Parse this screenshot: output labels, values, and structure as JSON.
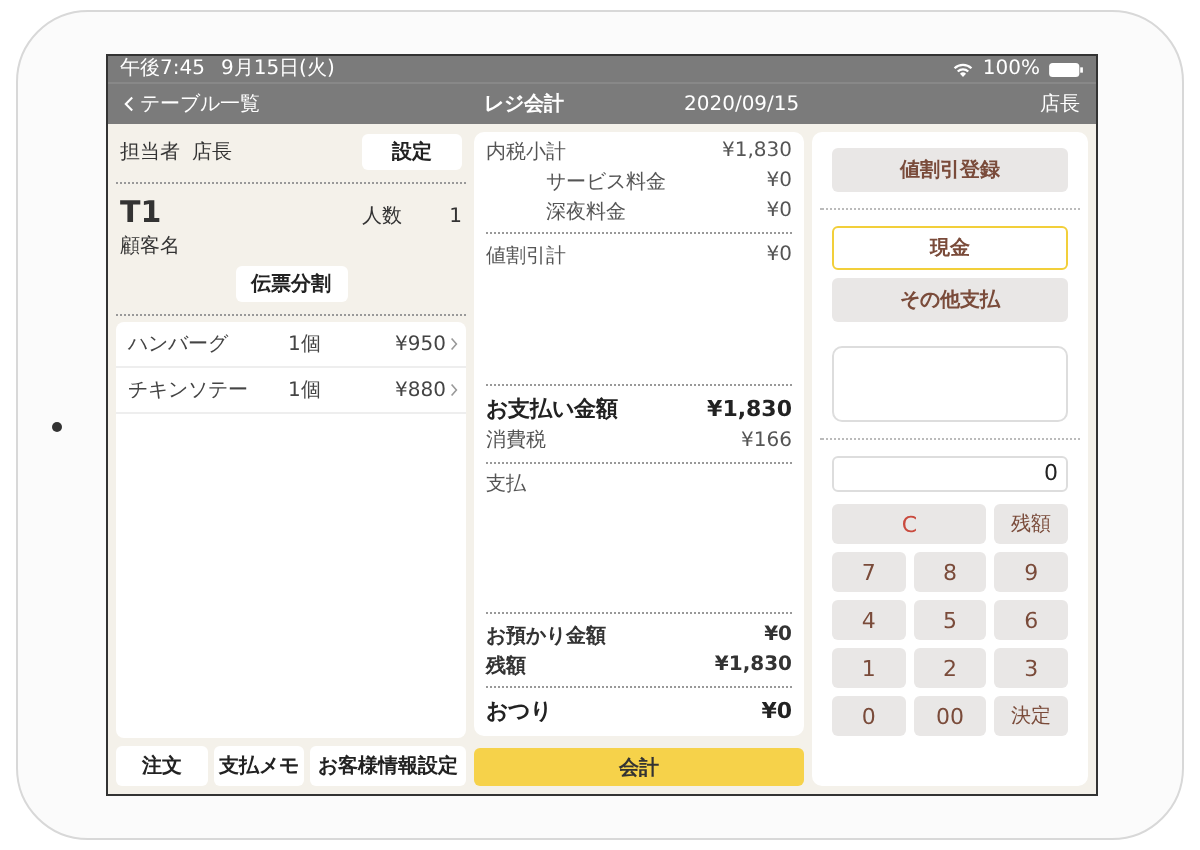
{
  "status_bar": {
    "time": "午後7:45",
    "date": "9月15日(火)",
    "battery": "100%"
  },
  "nav": {
    "back": "テーブル一覧",
    "title": "レジ会計",
    "date": "2020/09/15",
    "user": "店長"
  },
  "left": {
    "staff_label": "担当者",
    "staff_name": "店長",
    "settings_button": "設定",
    "table": "T1",
    "guests_label": "人数",
    "guests": "1",
    "customer_label": "顧客名",
    "split_button": "伝票分割",
    "items": [
      {
        "name": "ハンバーグ",
        "qty": "1個",
        "price": "¥950"
      },
      {
        "name": "チキンソテー",
        "qty": "1個",
        "price": "¥880"
      }
    ],
    "bottom_buttons": [
      "注文",
      "支払メモ",
      "お客様情報設定"
    ]
  },
  "summary": {
    "sections": [
      {
        "spacer": false,
        "rows": [
          {
            "kind": "normal",
            "label": "内税小計",
            "value": "¥1,830"
          },
          {
            "kind": "indent",
            "label": "サービス料金",
            "value": "¥0"
          },
          {
            "kind": "indent",
            "label": "深夜料金",
            "value": "¥0"
          }
        ]
      },
      {
        "spacer": true,
        "rows": [
          {
            "kind": "normal",
            "label": "値割引計",
            "value": "¥0"
          }
        ]
      },
      {
        "spacer": false,
        "rows": [
          {
            "kind": "total",
            "label": "お支払い金額",
            "value": "¥1,830"
          },
          {
            "kind": "normal",
            "label": "消費税",
            "value": "¥166"
          }
        ]
      },
      {
        "spacer": true,
        "rows": [
          {
            "kind": "normal",
            "label": "支払"
          }
        ]
      },
      {
        "spacer": false,
        "rows": [
          {
            "kind": "medium",
            "label": "お預かり金額",
            "value": "¥0"
          },
          {
            "kind": "medium",
            "label": "残額",
            "value": "¥1,830"
          }
        ]
      },
      {
        "spacer": false,
        "rows": [
          {
            "kind": "total",
            "label": "おつり",
            "value": "¥0"
          }
        ]
      }
    ],
    "checkout_button": "会計"
  },
  "right": {
    "discount_button": "値割引登録",
    "payment_methods": [
      {
        "label": "現金",
        "selected": true
      },
      {
        "label": "その他支払",
        "selected": false
      }
    ],
    "display": "0",
    "keys": [
      {
        "kind": "clear",
        "label": "C"
      },
      {
        "kind": "action",
        "label": "残額"
      },
      {
        "kind": "digit",
        "label": "7"
      },
      {
        "kind": "digit",
        "label": "8"
      },
      {
        "kind": "digit",
        "label": "9"
      },
      {
        "kind": "digit",
        "label": "4"
      },
      {
        "kind": "digit",
        "label": "5"
      },
      {
        "kind": "digit",
        "label": "6"
      },
      {
        "kind": "digit",
        "label": "1"
      },
      {
        "kind": "digit",
        "label": "2"
      },
      {
        "kind": "digit",
        "label": "3"
      },
      {
        "kind": "digit",
        "label": "0"
      },
      {
        "kind": "digit",
        "label": "00"
      },
      {
        "kind": "action",
        "label": "決定"
      }
    ]
  }
}
